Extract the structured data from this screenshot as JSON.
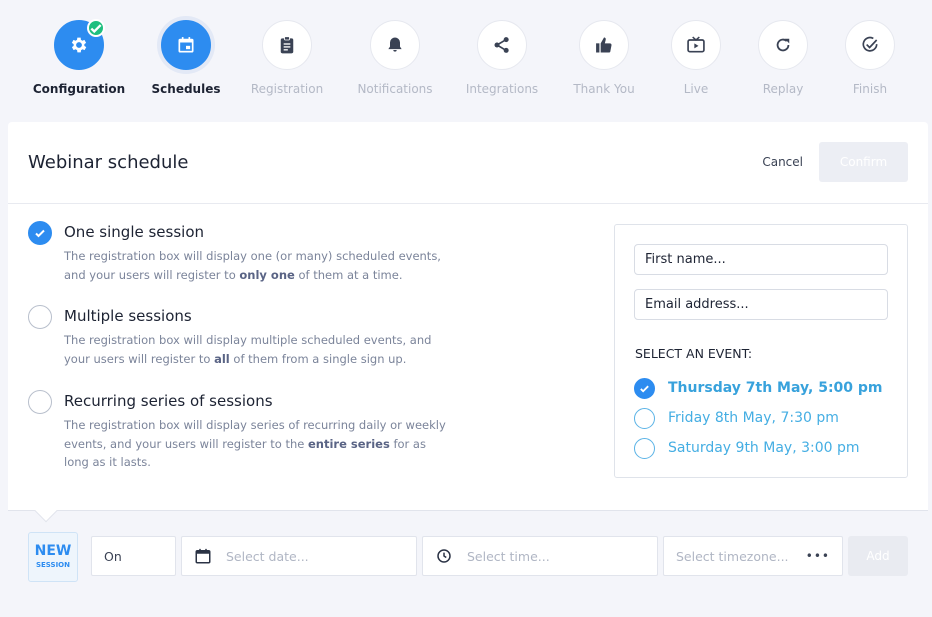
{
  "steps": [
    {
      "label": "Configuration",
      "icon": "gear-icon",
      "state": "done"
    },
    {
      "label": "Schedules",
      "icon": "calendar-icon",
      "state": "active"
    },
    {
      "label": "Registration",
      "icon": "clipboard-icon",
      "state": "pending"
    },
    {
      "label": "Notifications",
      "icon": "bell-icon",
      "state": "pending"
    },
    {
      "label": "Integrations",
      "icon": "share-icon",
      "state": "pending"
    },
    {
      "label": "Thank You",
      "icon": "thumbs-up-icon",
      "state": "pending"
    },
    {
      "label": "Live",
      "icon": "tv-icon",
      "state": "pending"
    },
    {
      "label": "Replay",
      "icon": "replay-icon",
      "state": "pending"
    },
    {
      "label": "Finish",
      "icon": "check-circle-icon",
      "state": "pending"
    }
  ],
  "header": {
    "title": "Webinar schedule",
    "cancel_label": "Cancel",
    "confirm_label": "Confirm"
  },
  "options": [
    {
      "title": "One single session",
      "desc_a": "The registration box will display one (or many) scheduled events, and your users will register to ",
      "desc_b": "only one",
      "desc_c": " of them at a time.",
      "checked": true
    },
    {
      "title": "Multiple sessions",
      "desc_a": "The registration box will display multiple scheduled events, and your users will register to ",
      "desc_b": "all",
      "desc_c": " of them from a single sign up.",
      "checked": false
    },
    {
      "title": "Recurring series of sessions",
      "desc_a": "The registration box will display series of recurring daily or weekly events, and your users will register to the ",
      "desc_b": "entire series",
      "desc_c": " for as long as it lasts.",
      "checked": false
    }
  ],
  "preview": {
    "first_name": "First name...",
    "email": "Email address...",
    "select_label": "SELECT AN EVENT:",
    "events": [
      {
        "label": "Thursday 7th May, 5:00 pm",
        "selected": true
      },
      {
        "label": "Friday 8th May, 7:30 pm",
        "selected": false
      },
      {
        "label": "Saturday 9th May, 3:00 pm",
        "selected": false
      }
    ]
  },
  "new_session": {
    "new_label": "NEW",
    "session_label": "SESSION",
    "on_value": "On",
    "date_placeholder": "Select date...",
    "time_placeholder": "Select time...",
    "timezone_placeholder": "Select timezone...",
    "timezone_menu": "•••",
    "add_label": "Add"
  },
  "colors": {
    "accent": "#2d8cf0",
    "success": "#1fbf7f",
    "event_text": "#45aee3"
  }
}
